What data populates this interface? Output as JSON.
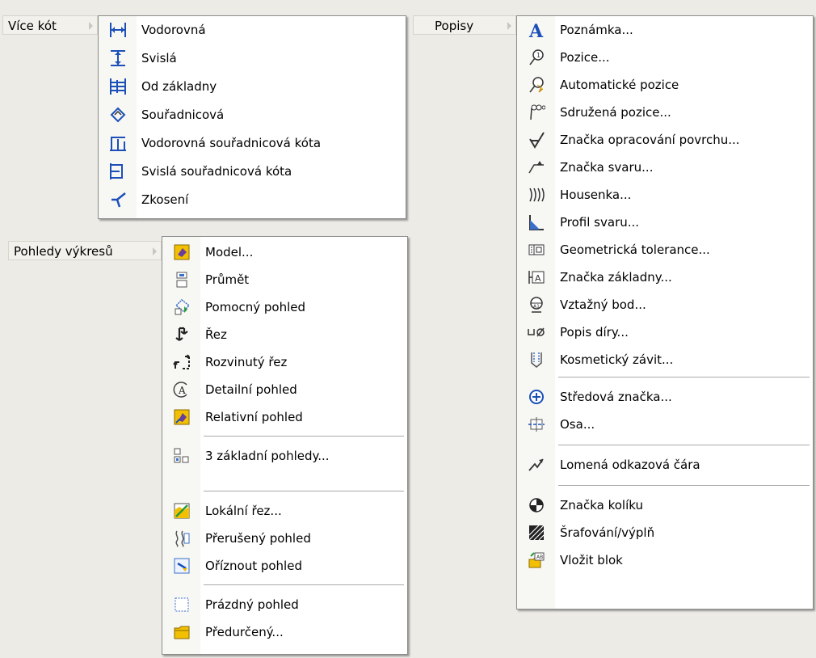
{
  "colors": {
    "accent_blue": "#1c50b8",
    "icon_dark": "#333333",
    "menu_bg": "#ffffff",
    "desktop_bg": "#ecebe6",
    "yellow": "#f2c000",
    "separator": "#a9a9a9"
  },
  "vice_kot": {
    "label": "Více kót",
    "items": [
      {
        "label": "Vodorovná",
        "icon": "horizontal-dimension-icon"
      },
      {
        "label": "Svislá",
        "icon": "vertical-dimension-icon"
      },
      {
        "label": "Od základny",
        "icon": "baseline-dimension-icon"
      },
      {
        "label": "Souřadnicová",
        "icon": "ordinate-dimension-icon"
      },
      {
        "label": "Vodorovná souřadnicová kóta",
        "icon": "horizontal-ordinate-icon"
      },
      {
        "label": "Svislá souřadnicová kóta",
        "icon": "vertical-ordinate-icon"
      },
      {
        "label": "Zkosení",
        "icon": "chamfer-icon"
      }
    ]
  },
  "pohledy": {
    "label": "Pohledy výkresů",
    "items": [
      {
        "label": "Model...",
        "icon": "model-view-icon"
      },
      {
        "label": "Průmět",
        "icon": "projected-view-icon"
      },
      {
        "label": "Pomocný pohled",
        "icon": "auxiliary-view-icon"
      },
      {
        "label": "Řez",
        "icon": "section-view-icon"
      },
      {
        "label": "Rozvinutý řez",
        "icon": "aligned-section-icon"
      },
      {
        "label": "Detailní pohled",
        "icon": "detail-view-icon"
      },
      {
        "label": "Relativní pohled",
        "icon": "relative-view-icon"
      },
      {
        "label": "3 základní pohledy...",
        "icon": "standard-views-icon"
      },
      {
        "label": "Lokální řez...",
        "icon": "broken-out-section-icon"
      },
      {
        "label": "Přerušený pohled",
        "icon": "break-view-icon"
      },
      {
        "label": "Oříznout pohled",
        "icon": "crop-view-icon"
      },
      {
        "label": "Prázdný pohled",
        "icon": "empty-view-icon"
      },
      {
        "label": "Předurčený...",
        "icon": "predefined-view-icon"
      }
    ]
  },
  "popisy": {
    "label": "Popisy",
    "items": [
      {
        "label": "Poznámka...",
        "icon": "note-icon"
      },
      {
        "label": "Pozice...",
        "icon": "balloon-icon"
      },
      {
        "label": "Automatické pozice",
        "icon": "auto-balloon-icon"
      },
      {
        "label": "Sdružená pozice...",
        "icon": "stacked-balloon-icon"
      },
      {
        "label": "Značka opracování povrchu...",
        "icon": "surface-finish-icon"
      },
      {
        "label": "Značka svaru...",
        "icon": "weld-symbol-icon"
      },
      {
        "label": "Housenka...",
        "icon": "weld-bead-icon"
      },
      {
        "label": "Profil svaru...",
        "icon": "weld-profile-icon"
      },
      {
        "label": "Geometrická tolerance...",
        "icon": "geometric-tolerance-icon"
      },
      {
        "label": "Značka základny...",
        "icon": "datum-feature-icon"
      },
      {
        "label": "Vztažný bod...",
        "icon": "datum-target-icon"
      },
      {
        "label": "Popis díry...",
        "icon": "hole-callout-icon"
      },
      {
        "label": "Kosmetický závit...",
        "icon": "cosmetic-thread-icon"
      },
      {
        "label": "Středová značka...",
        "icon": "center-mark-icon"
      },
      {
        "label": "Osa...",
        "icon": "centerline-icon"
      },
      {
        "label": "Lomená odkazová čára",
        "icon": "multi-jog-leader-icon"
      },
      {
        "label": "Značka kolíku",
        "icon": "dowel-pin-icon"
      },
      {
        "label": "Šrafování/výplň",
        "icon": "hatch-fill-icon"
      },
      {
        "label": "Vložit blok",
        "icon": "insert-block-icon"
      }
    ]
  }
}
